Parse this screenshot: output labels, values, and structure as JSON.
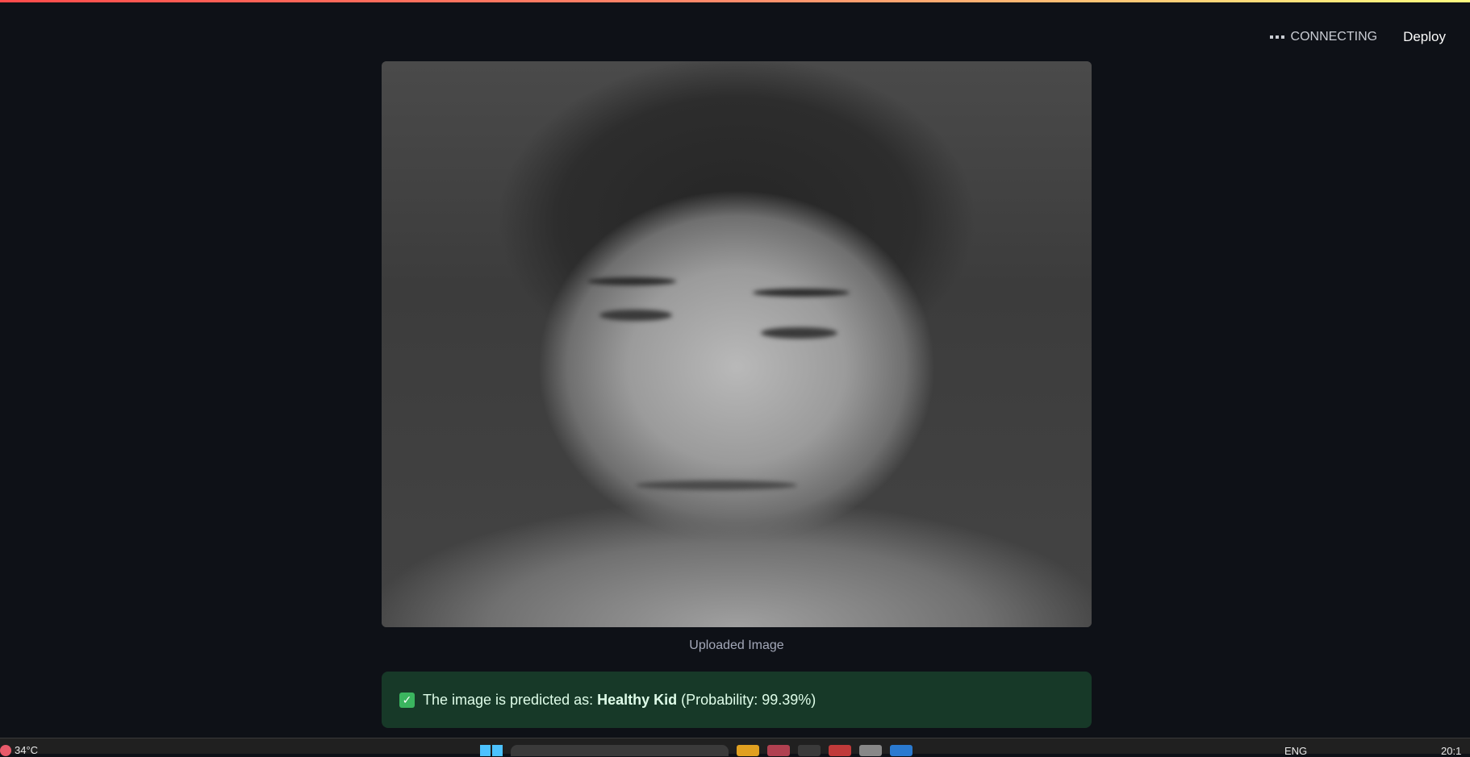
{
  "header": {
    "status_label": "CONNECTING",
    "deploy_label": "Deploy"
  },
  "main": {
    "image_caption": "Uploaded Image",
    "result": {
      "prefix": "The image is predicted as:",
      "label": "Healthy Kid",
      "suffix": "(Probability: 99.39%)"
    }
  },
  "taskbar": {
    "temperature": "34°C",
    "language": "ENG",
    "time": "20:1"
  },
  "colors": {
    "background": "#0e1117",
    "alert_background": "#173928",
    "alert_text": "#dffde9",
    "check": "#3bb55f"
  }
}
